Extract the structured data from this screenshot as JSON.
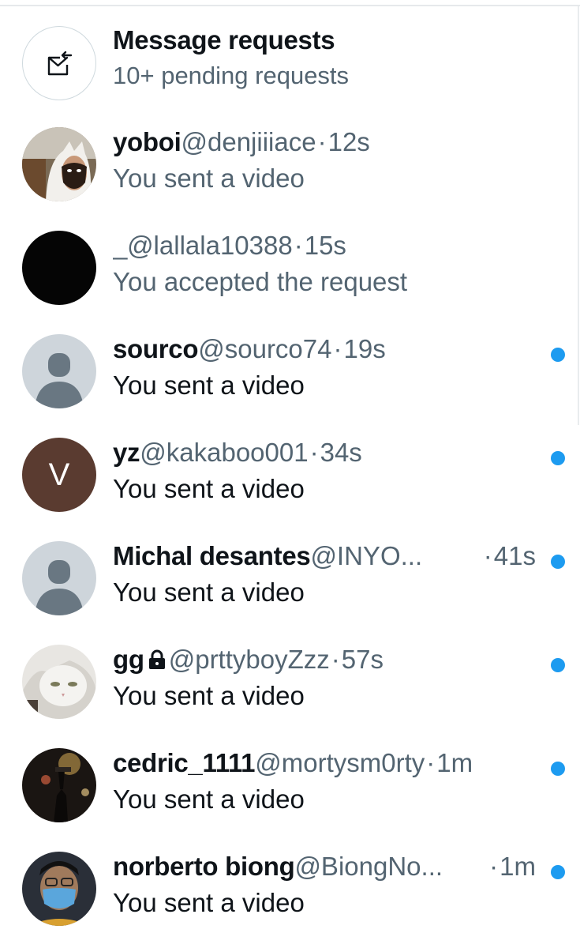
{
  "header": {
    "title": "Message requests",
    "subtitle": "10+ pending requests",
    "icon": "envelope-arrow-icon"
  },
  "colors": {
    "accent": "#1d9bf0",
    "text_primary": "#0f1419",
    "text_secondary": "#536471"
  },
  "conversations": [
    {
      "name": "yoboi",
      "handle": "@denjiiiace",
      "separator": "·",
      "time": "12s",
      "preview": "You sent a video",
      "unread": false,
      "avatar": "cat-photo-avatar"
    },
    {
      "name": "_",
      "handle": "@lallala10388",
      "separator": "·",
      "time": "15s",
      "preview": "You accepted the request",
      "unread": false,
      "avatar": "black-avatar"
    },
    {
      "name": "sourco",
      "handle": "@sourco74",
      "separator": "·",
      "time": "19s",
      "preview": "You sent a video",
      "unread": true,
      "avatar": "default-profile-avatar"
    },
    {
      "name": "yz",
      "handle": "@kakaboo001",
      "separator": "·",
      "time": "34s",
      "preview": "You sent a video",
      "unread": true,
      "avatar": "letter-v-avatar",
      "avatar_letter": "V"
    },
    {
      "name": "Michal desantes",
      "handle": "@INYO...",
      "separator": "·",
      "time": "41s",
      "preview": "You sent a video",
      "unread": true,
      "avatar": "default-profile-avatar"
    },
    {
      "name": "gg",
      "handle": "@prttyboyZzz",
      "separator": "·",
      "time": "57s",
      "preview": "You sent a video",
      "unread": true,
      "avatar": "white-cat-avatar",
      "protected": true
    },
    {
      "name": "cedric_1111",
      "handle": "@mortysm0rty",
      "separator": "·",
      "time": "1m",
      "preview": "You sent a video",
      "unread": true,
      "avatar": "night-photo-avatar"
    },
    {
      "name": "norberto biong",
      "handle": "@BiongNo...",
      "separator": "·",
      "time": "1m",
      "preview": "You sent a video",
      "unread": true,
      "avatar": "masked-person-avatar"
    }
  ]
}
